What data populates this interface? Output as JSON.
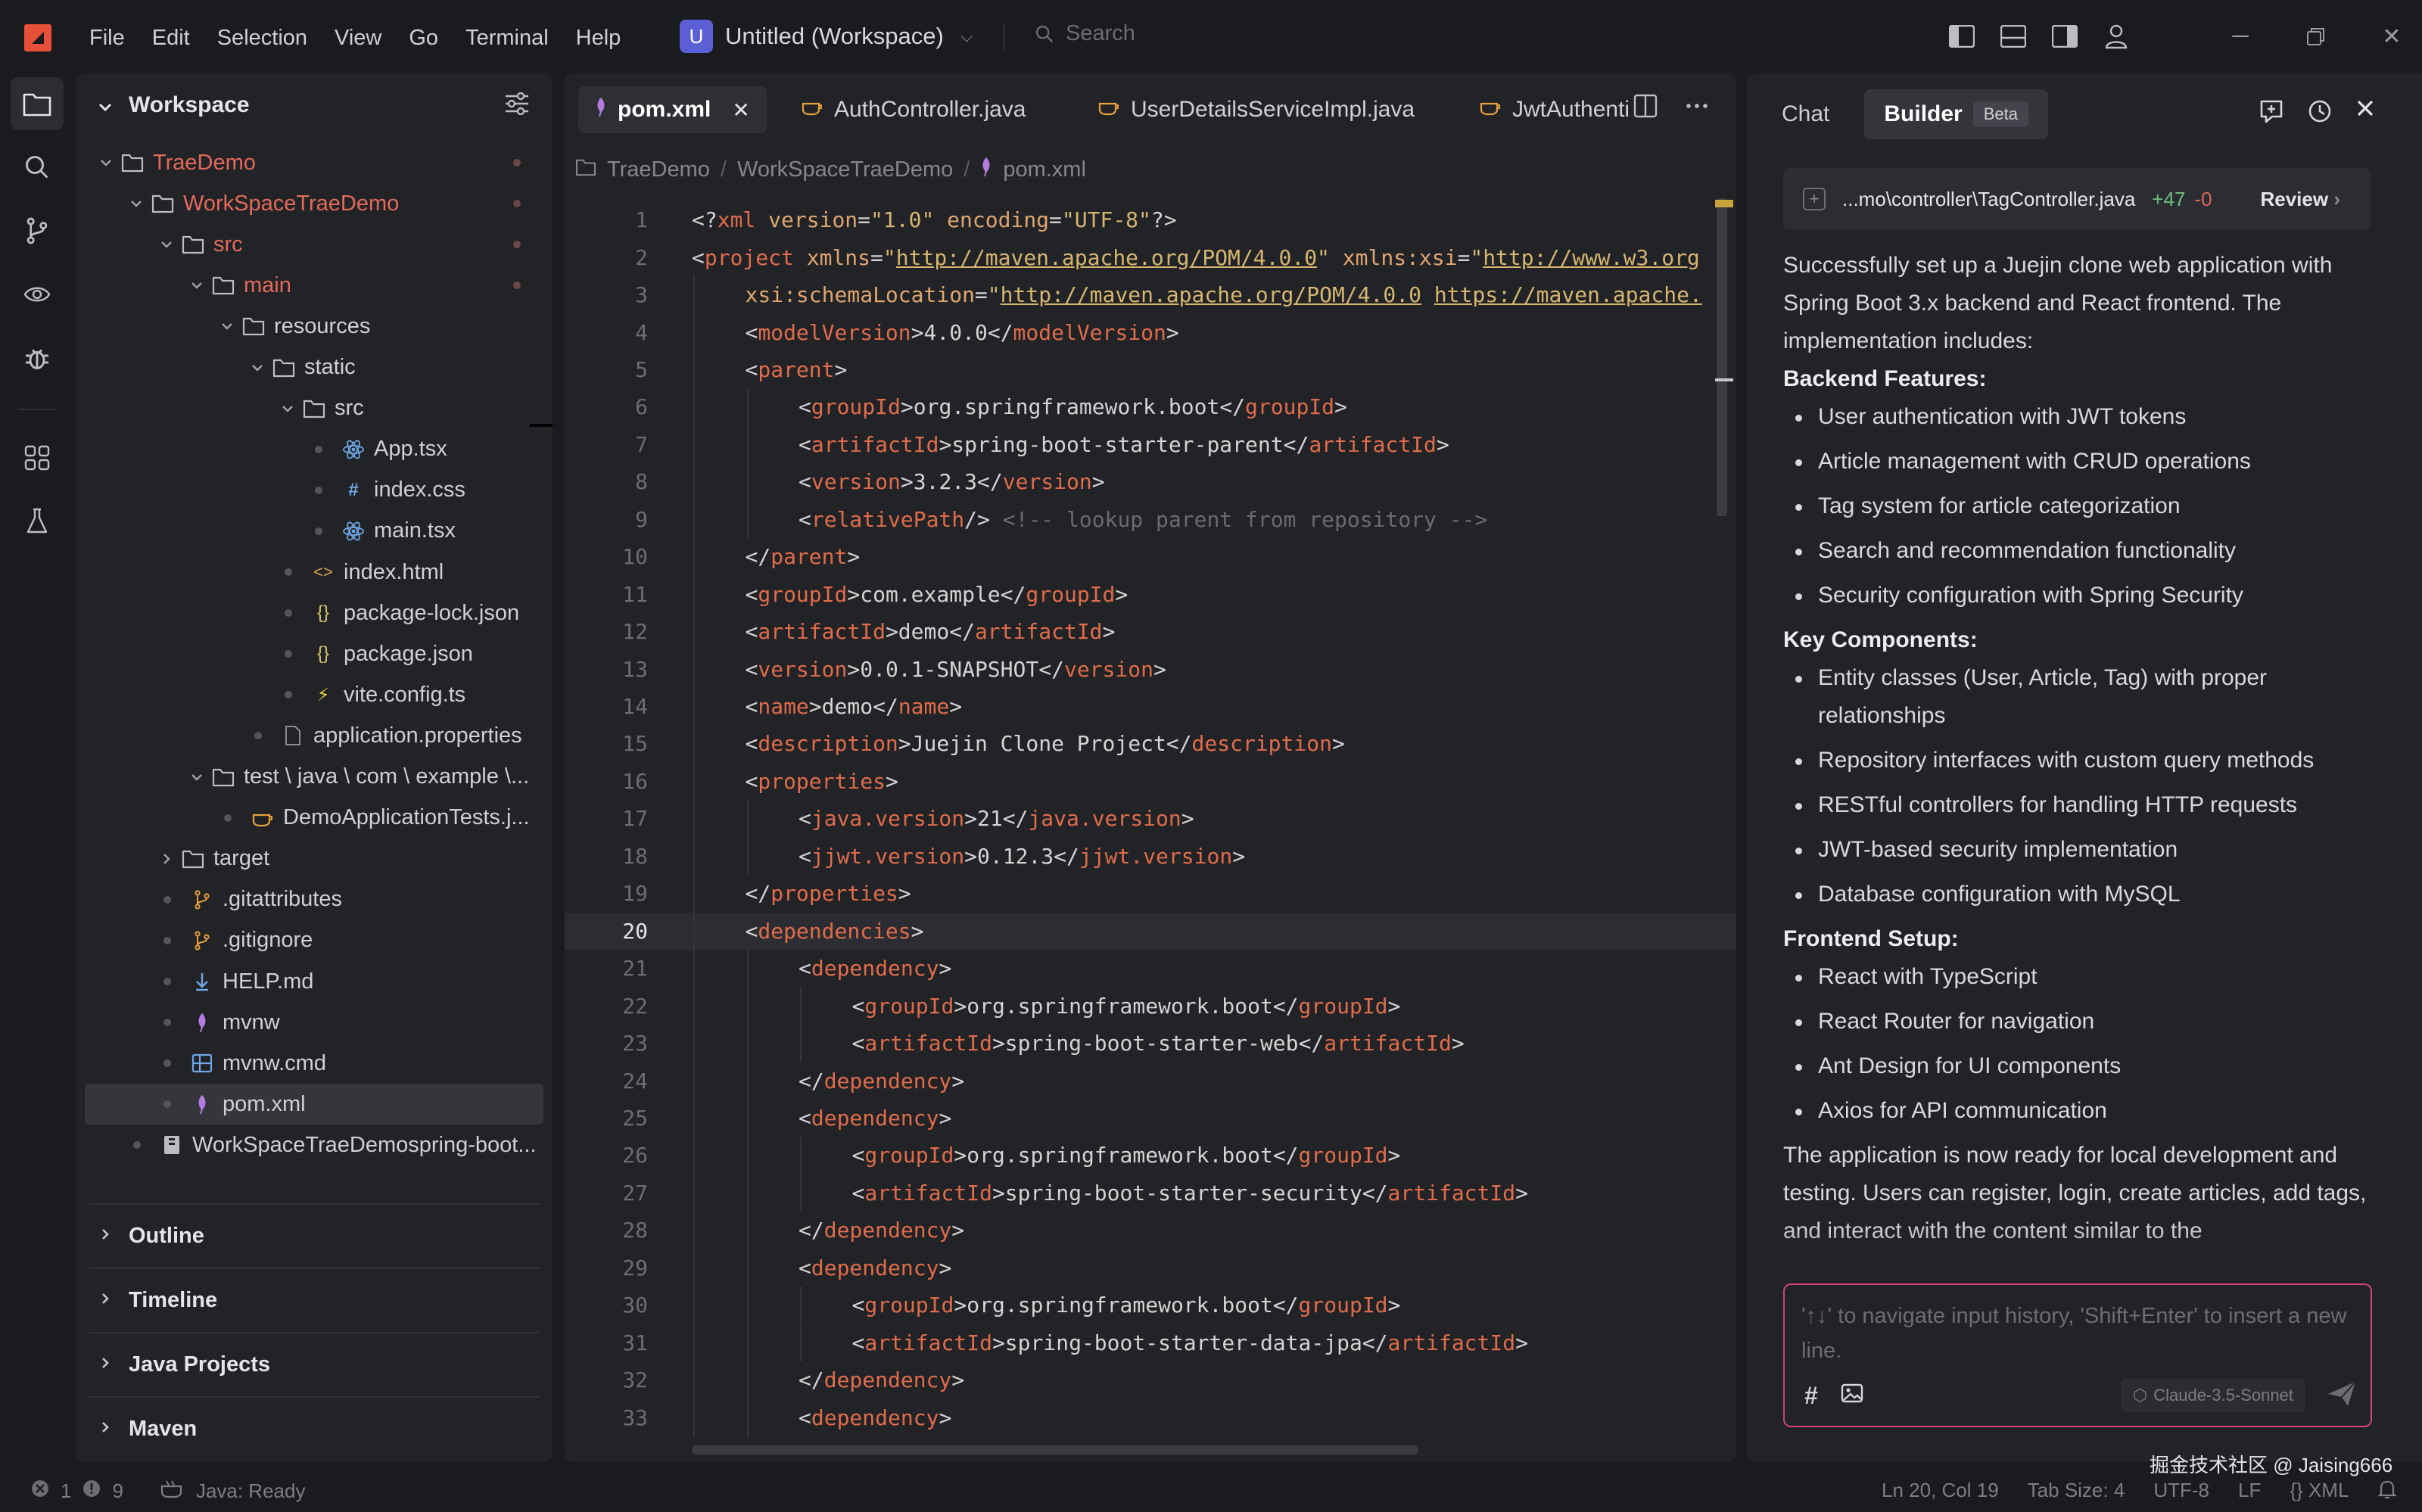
{
  "menu": [
    "File",
    "Edit",
    "Selection",
    "View",
    "Go",
    "Terminal",
    "Help"
  ],
  "workspace": {
    "badge": "U",
    "title": "Untitled (Workspace)"
  },
  "search": {
    "placeholder": "Search"
  },
  "explorer": {
    "title": "Workspace",
    "tree": [
      {
        "label": "TraeDemo",
        "kind": "folder",
        "open": true,
        "modified": true
      },
      {
        "label": "WorkSpaceTraeDemo",
        "kind": "folder",
        "open": true,
        "modified": true
      },
      {
        "label": "src",
        "kind": "folder",
        "open": true,
        "modified": true
      },
      {
        "label": "main",
        "kind": "folder",
        "open": true,
        "modified": true
      },
      {
        "label": "resources",
        "kind": "folder",
        "open": true
      },
      {
        "label": "static",
        "kind": "folder",
        "open": true
      },
      {
        "label": "src",
        "kind": "folder",
        "open": true
      },
      {
        "label": "App.tsx",
        "kind": "react"
      },
      {
        "label": "index.css",
        "kind": "css"
      },
      {
        "label": "main.tsx",
        "kind": "react"
      },
      {
        "label": "index.html",
        "kind": "html"
      },
      {
        "label": "package-lock.json",
        "kind": "json"
      },
      {
        "label": "package.json",
        "kind": "json"
      },
      {
        "label": "vite.config.ts",
        "kind": "vite"
      },
      {
        "label": "application.properties",
        "kind": "file"
      },
      {
        "label": "test \\ java \\ com \\ example \\...",
        "kind": "folder",
        "open": true
      },
      {
        "label": "DemoApplicationTests.j...",
        "kind": "java"
      },
      {
        "label": "target",
        "kind": "folder",
        "open": false
      },
      {
        "label": ".gitattributes",
        "kind": "git"
      },
      {
        "label": ".gitignore",
        "kind": "git"
      },
      {
        "label": "HELP.md",
        "kind": "md"
      },
      {
        "label": "mvnw",
        "kind": "maven"
      },
      {
        "label": "mvnw.cmd",
        "kind": "cmd"
      },
      {
        "label": "pom.xml",
        "kind": "maven",
        "selected": true
      },
      {
        "label": "WorkSpaceTraeDemospring-boot...",
        "kind": "archive"
      }
    ],
    "sections": [
      "Outline",
      "Timeline",
      "Java Projects",
      "Maven"
    ]
  },
  "editor": {
    "tabs": [
      {
        "label": "pom.xml",
        "active": true
      },
      {
        "label": "AuthController.java"
      },
      {
        "label": "UserDetailsServiceImpl.java"
      },
      {
        "label": "JwtAuthenti"
      }
    ],
    "breadcrumb": [
      "TraeDemo",
      "WorkSpaceTraeDemo",
      "pom.xml"
    ],
    "current_line": 20,
    "lines": [
      {
        "n": "1",
        "indent": 0,
        "tokens": [
          [
            "b",
            "<?"
          ],
          [
            "t",
            "xml"
          ],
          [
            "a",
            " version"
          ],
          [
            "b",
            "="
          ],
          [
            "s",
            "\"1.0\""
          ],
          [
            "a",
            " encoding"
          ],
          [
            "b",
            "="
          ],
          [
            "s",
            "\"UTF-8\""
          ],
          [
            "b",
            "?>"
          ]
        ]
      },
      {
        "n": "2",
        "indent": 0,
        "tokens": [
          [
            "b",
            "<"
          ],
          [
            "t",
            "project"
          ],
          [
            "a",
            " xmlns"
          ],
          [
            "b",
            "="
          ],
          [
            "s",
            "\""
          ],
          [
            "u",
            "http://maven.apache.org/POM/4.0.0"
          ],
          [
            "s",
            "\""
          ],
          [
            "a",
            " xmlns:xsi"
          ],
          [
            "b",
            "="
          ],
          [
            "s",
            "\""
          ],
          [
            "u",
            "http://www.w3.org"
          ]
        ]
      },
      {
        "n": "3",
        "indent": 1,
        "tokens": [
          [
            "a",
            "xsi:schemaLocation"
          ],
          [
            "b",
            "="
          ],
          [
            "s",
            "\""
          ],
          [
            "u",
            "http://maven.apache.org/POM/4.0.0"
          ],
          [
            "s",
            " "
          ],
          [
            "u",
            "https://maven.apache."
          ]
        ]
      },
      {
        "n": "4",
        "indent": 1,
        "tokens": [
          [
            "b",
            "<"
          ],
          [
            "t",
            "modelVersion"
          ],
          [
            "b",
            ">"
          ],
          [
            "x",
            "4.0.0"
          ],
          [
            "b",
            "</"
          ],
          [
            "t",
            "modelVersion"
          ],
          [
            "b",
            ">"
          ]
        ]
      },
      {
        "n": "5",
        "indent": 1,
        "tokens": [
          [
            "b",
            "<"
          ],
          [
            "t",
            "parent"
          ],
          [
            "b",
            ">"
          ]
        ]
      },
      {
        "n": "6",
        "indent": 2,
        "tokens": [
          [
            "b",
            "<"
          ],
          [
            "t",
            "groupId"
          ],
          [
            "b",
            ">"
          ],
          [
            "x",
            "org.springframework.boot"
          ],
          [
            "b",
            "</"
          ],
          [
            "t",
            "groupId"
          ],
          [
            "b",
            ">"
          ]
        ]
      },
      {
        "n": "7",
        "indent": 2,
        "tokens": [
          [
            "b",
            "<"
          ],
          [
            "t",
            "artifactId"
          ],
          [
            "b",
            ">"
          ],
          [
            "x",
            "spring-boot-starter-parent"
          ],
          [
            "b",
            "</"
          ],
          [
            "t",
            "artifactId"
          ],
          [
            "b",
            ">"
          ]
        ]
      },
      {
        "n": "8",
        "indent": 2,
        "tokens": [
          [
            "b",
            "<"
          ],
          [
            "t",
            "version"
          ],
          [
            "b",
            ">"
          ],
          [
            "x",
            "3.2.3"
          ],
          [
            "b",
            "</"
          ],
          [
            "t",
            "version"
          ],
          [
            "b",
            ">"
          ]
        ]
      },
      {
        "n": "9",
        "indent": 2,
        "tokens": [
          [
            "b",
            "<"
          ],
          [
            "t",
            "relativePath"
          ],
          [
            "b",
            "/>"
          ],
          [
            "c",
            " <!-- lookup parent from repository -->"
          ]
        ]
      },
      {
        "n": "10",
        "indent": 1,
        "tokens": [
          [
            "b",
            "</"
          ],
          [
            "t",
            "parent"
          ],
          [
            "b",
            ">"
          ]
        ]
      },
      {
        "n": "11",
        "indent": 1,
        "tokens": [
          [
            "b",
            "<"
          ],
          [
            "t",
            "groupId"
          ],
          [
            "b",
            ">"
          ],
          [
            "x",
            "com.example"
          ],
          [
            "b",
            "</"
          ],
          [
            "t",
            "groupId"
          ],
          [
            "b",
            ">"
          ]
        ]
      },
      {
        "n": "12",
        "indent": 1,
        "tokens": [
          [
            "b",
            "<"
          ],
          [
            "t",
            "artifactId"
          ],
          [
            "b",
            ">"
          ],
          [
            "x",
            "demo"
          ],
          [
            "b",
            "</"
          ],
          [
            "t",
            "artifactId"
          ],
          [
            "b",
            ">"
          ]
        ]
      },
      {
        "n": "13",
        "indent": 1,
        "tokens": [
          [
            "b",
            "<"
          ],
          [
            "t",
            "version"
          ],
          [
            "b",
            ">"
          ],
          [
            "x",
            "0.0.1-SNAPSHOT"
          ],
          [
            "b",
            "</"
          ],
          [
            "t",
            "version"
          ],
          [
            "b",
            ">"
          ]
        ]
      },
      {
        "n": "14",
        "indent": 1,
        "tokens": [
          [
            "b",
            "<"
          ],
          [
            "t",
            "name"
          ],
          [
            "b",
            ">"
          ],
          [
            "x",
            "demo"
          ],
          [
            "b",
            "</"
          ],
          [
            "t",
            "name"
          ],
          [
            "b",
            ">"
          ]
        ]
      },
      {
        "n": "15",
        "indent": 1,
        "tokens": [
          [
            "b",
            "<"
          ],
          [
            "t",
            "description"
          ],
          [
            "b",
            ">"
          ],
          [
            "x",
            "Juejin Clone Project"
          ],
          [
            "b",
            "</"
          ],
          [
            "t",
            "description"
          ],
          [
            "b",
            ">"
          ]
        ]
      },
      {
        "n": "16",
        "indent": 1,
        "tokens": [
          [
            "b",
            "<"
          ],
          [
            "t",
            "properties"
          ],
          [
            "b",
            ">"
          ]
        ]
      },
      {
        "n": "17",
        "indent": 2,
        "tokens": [
          [
            "b",
            "<"
          ],
          [
            "t",
            "java.version"
          ],
          [
            "b",
            ">"
          ],
          [
            "x",
            "21"
          ],
          [
            "b",
            "</"
          ],
          [
            "t",
            "java.version"
          ],
          [
            "b",
            ">"
          ]
        ]
      },
      {
        "n": "18",
        "indent": 2,
        "tokens": [
          [
            "b",
            "<"
          ],
          [
            "t",
            "jjwt.version"
          ],
          [
            "b",
            ">"
          ],
          [
            "x",
            "0.12.3"
          ],
          [
            "b",
            "</"
          ],
          [
            "t",
            "jjwt.version"
          ],
          [
            "b",
            ">"
          ]
        ]
      },
      {
        "n": "19",
        "indent": 1,
        "tokens": [
          [
            "b",
            "</"
          ],
          [
            "t",
            "properties"
          ],
          [
            "b",
            ">"
          ]
        ]
      },
      {
        "n": "20",
        "indent": 1,
        "tokens": [
          [
            "b",
            "<"
          ],
          [
            "t",
            "dependencies"
          ],
          [
            "b",
            ">"
          ]
        ]
      },
      {
        "n": "21",
        "indent": 2,
        "tokens": [
          [
            "b",
            "<"
          ],
          [
            "t",
            "dependency"
          ],
          [
            "b",
            ">"
          ]
        ]
      },
      {
        "n": "22",
        "indent": 3,
        "tokens": [
          [
            "b",
            "<"
          ],
          [
            "t",
            "groupId"
          ],
          [
            "b",
            ">"
          ],
          [
            "x",
            "org.springframework.boot"
          ],
          [
            "b",
            "</"
          ],
          [
            "t",
            "groupId"
          ],
          [
            "b",
            ">"
          ]
        ]
      },
      {
        "n": "23",
        "indent": 3,
        "tokens": [
          [
            "b",
            "<"
          ],
          [
            "t",
            "artifactId"
          ],
          [
            "b",
            ">"
          ],
          [
            "x",
            "spring-boot-starter-web"
          ],
          [
            "b",
            "</"
          ],
          [
            "t",
            "artifactId"
          ],
          [
            "b",
            ">"
          ]
        ]
      },
      {
        "n": "24",
        "indent": 2,
        "tokens": [
          [
            "b",
            "</"
          ],
          [
            "t",
            "dependency"
          ],
          [
            "b",
            ">"
          ]
        ]
      },
      {
        "n": "25",
        "indent": 2,
        "tokens": [
          [
            "b",
            "<"
          ],
          [
            "t",
            "dependency"
          ],
          [
            "b",
            ">"
          ]
        ]
      },
      {
        "n": "26",
        "indent": 3,
        "tokens": [
          [
            "b",
            "<"
          ],
          [
            "t",
            "groupId"
          ],
          [
            "b",
            ">"
          ],
          [
            "x",
            "org.springframework.boot"
          ],
          [
            "b",
            "</"
          ],
          [
            "t",
            "groupId"
          ],
          [
            "b",
            ">"
          ]
        ]
      },
      {
        "n": "27",
        "indent": 3,
        "tokens": [
          [
            "b",
            "<"
          ],
          [
            "t",
            "artifactId"
          ],
          [
            "b",
            ">"
          ],
          [
            "x",
            "spring-boot-starter-security"
          ],
          [
            "b",
            "</"
          ],
          [
            "t",
            "artifactId"
          ],
          [
            "b",
            ">"
          ]
        ]
      },
      {
        "n": "28",
        "indent": 2,
        "tokens": [
          [
            "b",
            "</"
          ],
          [
            "t",
            "dependency"
          ],
          [
            "b",
            ">"
          ]
        ]
      },
      {
        "n": "29",
        "indent": 2,
        "tokens": [
          [
            "b",
            "<"
          ],
          [
            "t",
            "dependency"
          ],
          [
            "b",
            ">"
          ]
        ]
      },
      {
        "n": "30",
        "indent": 3,
        "tokens": [
          [
            "b",
            "<"
          ],
          [
            "t",
            "groupId"
          ],
          [
            "b",
            ">"
          ],
          [
            "x",
            "org.springframework.boot"
          ],
          [
            "b",
            "</"
          ],
          [
            "t",
            "groupId"
          ],
          [
            "b",
            ">"
          ]
        ]
      },
      {
        "n": "31",
        "indent": 3,
        "tokens": [
          [
            "b",
            "<"
          ],
          [
            "t",
            "artifactId"
          ],
          [
            "b",
            ">"
          ],
          [
            "x",
            "spring-boot-starter-data-jpa"
          ],
          [
            "b",
            "</"
          ],
          [
            "t",
            "artifactId"
          ],
          [
            "b",
            ">"
          ]
        ]
      },
      {
        "n": "32",
        "indent": 2,
        "tokens": [
          [
            "b",
            "</"
          ],
          [
            "t",
            "dependency"
          ],
          [
            "b",
            ">"
          ]
        ]
      },
      {
        "n": "33",
        "indent": 2,
        "tokens": [
          [
            "b",
            "<"
          ],
          [
            "t",
            "dependency"
          ],
          [
            "b",
            ">"
          ]
        ]
      }
    ]
  },
  "chat": {
    "tabs": {
      "chat": "Chat",
      "builder": "Builder",
      "beta": "Beta"
    },
    "change": {
      "file": "...mo\\controller\\TagController.java",
      "added": "+47",
      "removed": "-0",
      "review": "Review"
    },
    "intro": "Successfully set up a Juejin clone web application with Spring Boot 3.x backend and React frontend. The implementation includes:",
    "sections": [
      {
        "heading": "Backend Features:",
        "items": [
          "User authentication with JWT tokens",
          "Article management with CRUD operations",
          "Tag system for article categorization",
          "Search and recommendation functionality",
          "Security configuration with Spring Security"
        ]
      },
      {
        "heading": "Key Components:",
        "items": [
          "Entity classes (User, Article, Tag) with proper relationships",
          "Repository interfaces with custom query methods",
          "RESTful controllers for handling HTTP requests",
          "JWT-based security implementation",
          "Database configuration with MySQL"
        ]
      },
      {
        "heading": "Frontend Setup:",
        "items": [
          "React with TypeScript",
          "React Router for navigation",
          "Ant Design for UI components",
          "Axios for API communication"
        ]
      }
    ],
    "outro": "The application is now ready for local development and testing. Users can register, login, create articles, add tags, and interact with the content similar to the",
    "input_placeholder": "'↑↓' to navigate input history, 'Shift+Enter' to insert a new line.",
    "model": "Claude-3.5-Sonnet"
  },
  "status": {
    "errors": "1",
    "warnings": "9",
    "java": "Java: Ready",
    "position": "Ln 20, Col 19",
    "tab_size": "Tab Size: 4",
    "encoding": "UTF-8",
    "eol": "LF",
    "language": "XML"
  },
  "watermark": "掘金技术社区 @ Jaising666"
}
